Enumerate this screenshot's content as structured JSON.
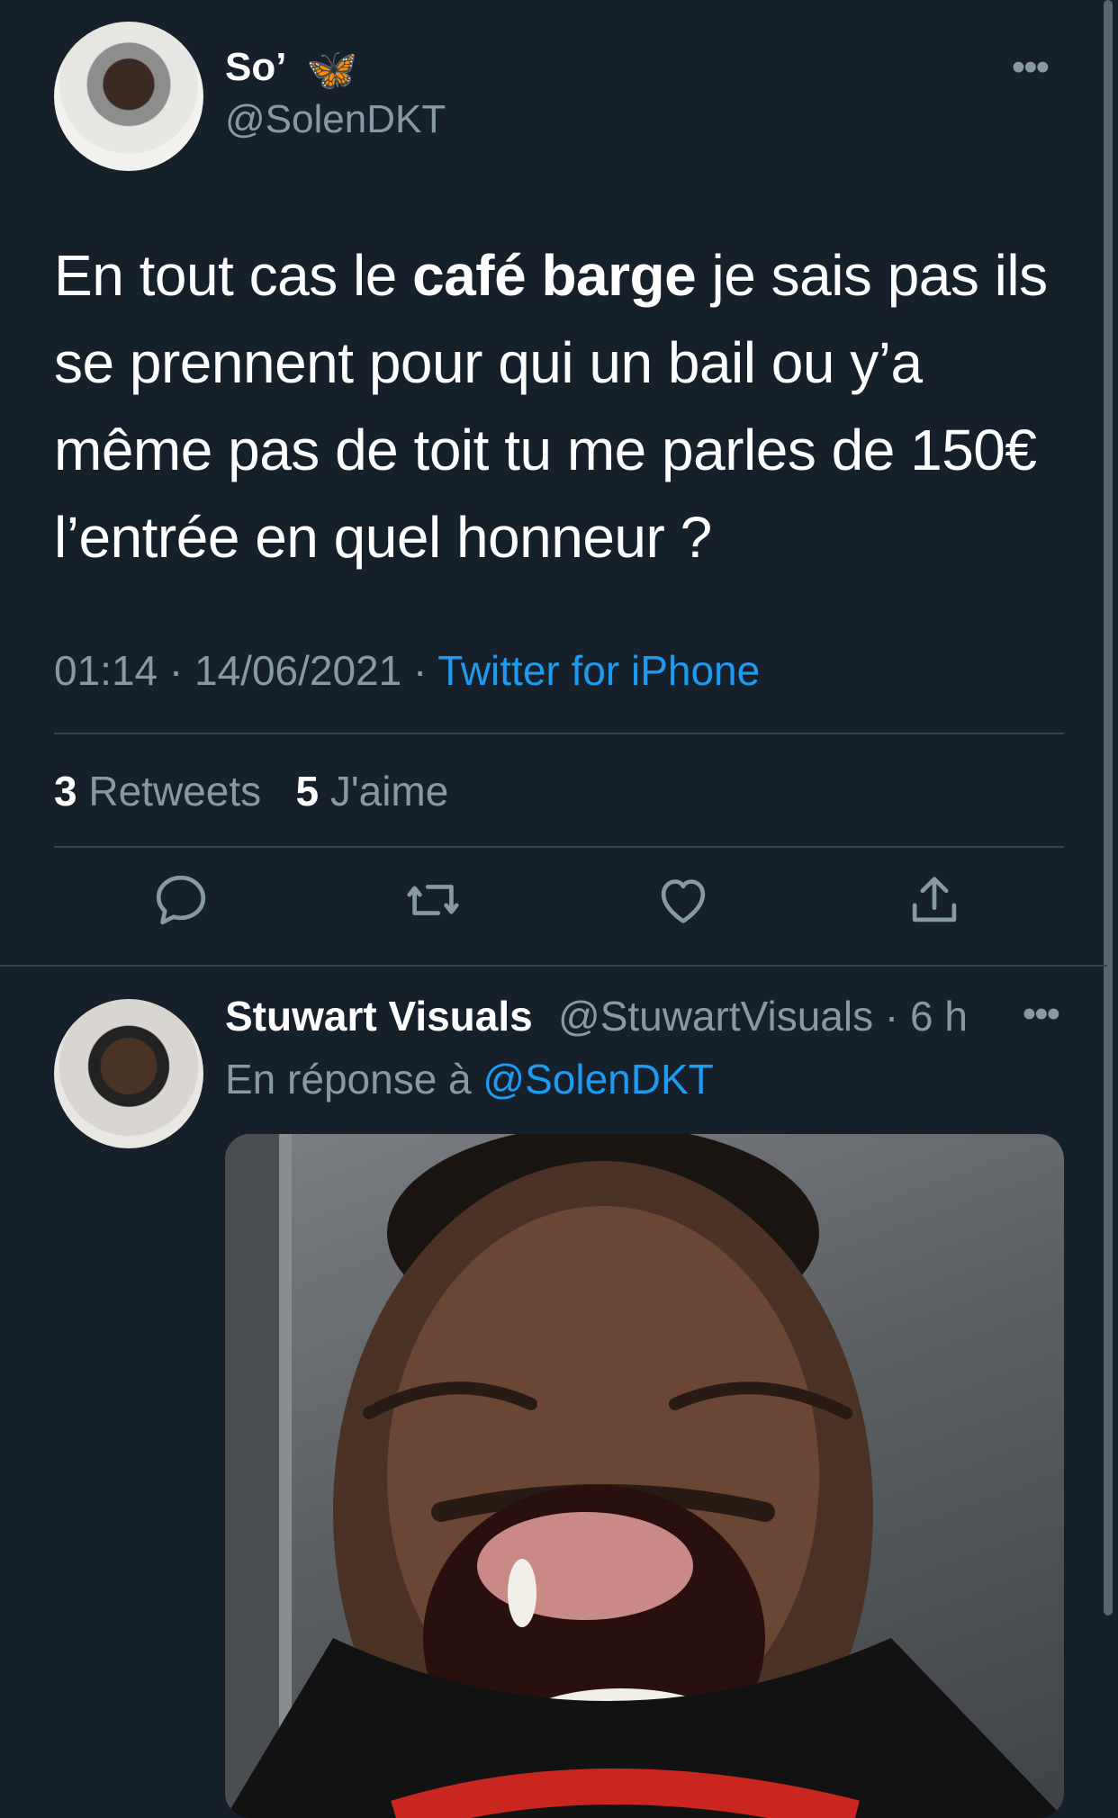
{
  "tweet": {
    "display_name": "So’",
    "badge_emoji": "🦋",
    "handle": "@SolenDKT",
    "text_part1": "En tout cas le ",
    "text_bold": "café barge",
    "text_part2": " je sais pas ils se prennent pour qui un bail ou y’a même pas de toit tu me parles de 150€ l’entrée en quel honneur ?",
    "timestamp": "01:14 · 14/06/2021 · ",
    "source": "Twitter for iPhone",
    "retweets_count": "3",
    "retweets_label": " Retweets",
    "likes_count": "5",
    "likes_label": " J'aime",
    "more": "•••"
  },
  "actions": [
    {
      "icon": "reply-icon"
    },
    {
      "icon": "retweet-icon"
    },
    {
      "icon": "like-icon"
    },
    {
      "icon": "share-icon"
    }
  ],
  "reply": {
    "display_name": "Stuwart Visuals",
    "handle_time": "@StuwartVisuals · 6 h",
    "reply_prefix": "En réponse à ",
    "reply_mention": "@SolenDKT",
    "more": "•••"
  },
  "colors": {
    "background": "#15202b",
    "secondary_text": "#8899a6",
    "accent": "#1d9bf0",
    "divider": "#38444d"
  }
}
